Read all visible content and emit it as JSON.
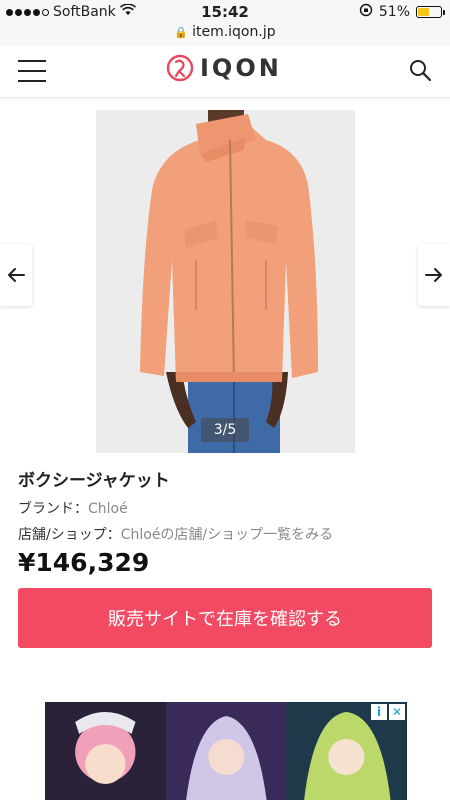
{
  "status_bar": {
    "carrier": "SoftBank",
    "time": "15:42",
    "battery_percent": "51%",
    "battery_level": 0.51
  },
  "url_bar": {
    "url": "item.iqon.jp"
  },
  "header": {
    "logo_text": "IQON"
  },
  "gallery": {
    "counter": "3/5"
  },
  "product": {
    "title": "ボクシージャケット",
    "brand_label": "ブランド：",
    "brand_value": "Chloé",
    "shop_label": "店舗/ショップ：",
    "shop_value": "Chloéの店舗/ショップ一覧をみる",
    "price": "¥146,329",
    "cta_label": "販売サイトで在庫を確認する"
  },
  "colors": {
    "accent": "#f24a62",
    "jacket": "#f2a07a"
  }
}
